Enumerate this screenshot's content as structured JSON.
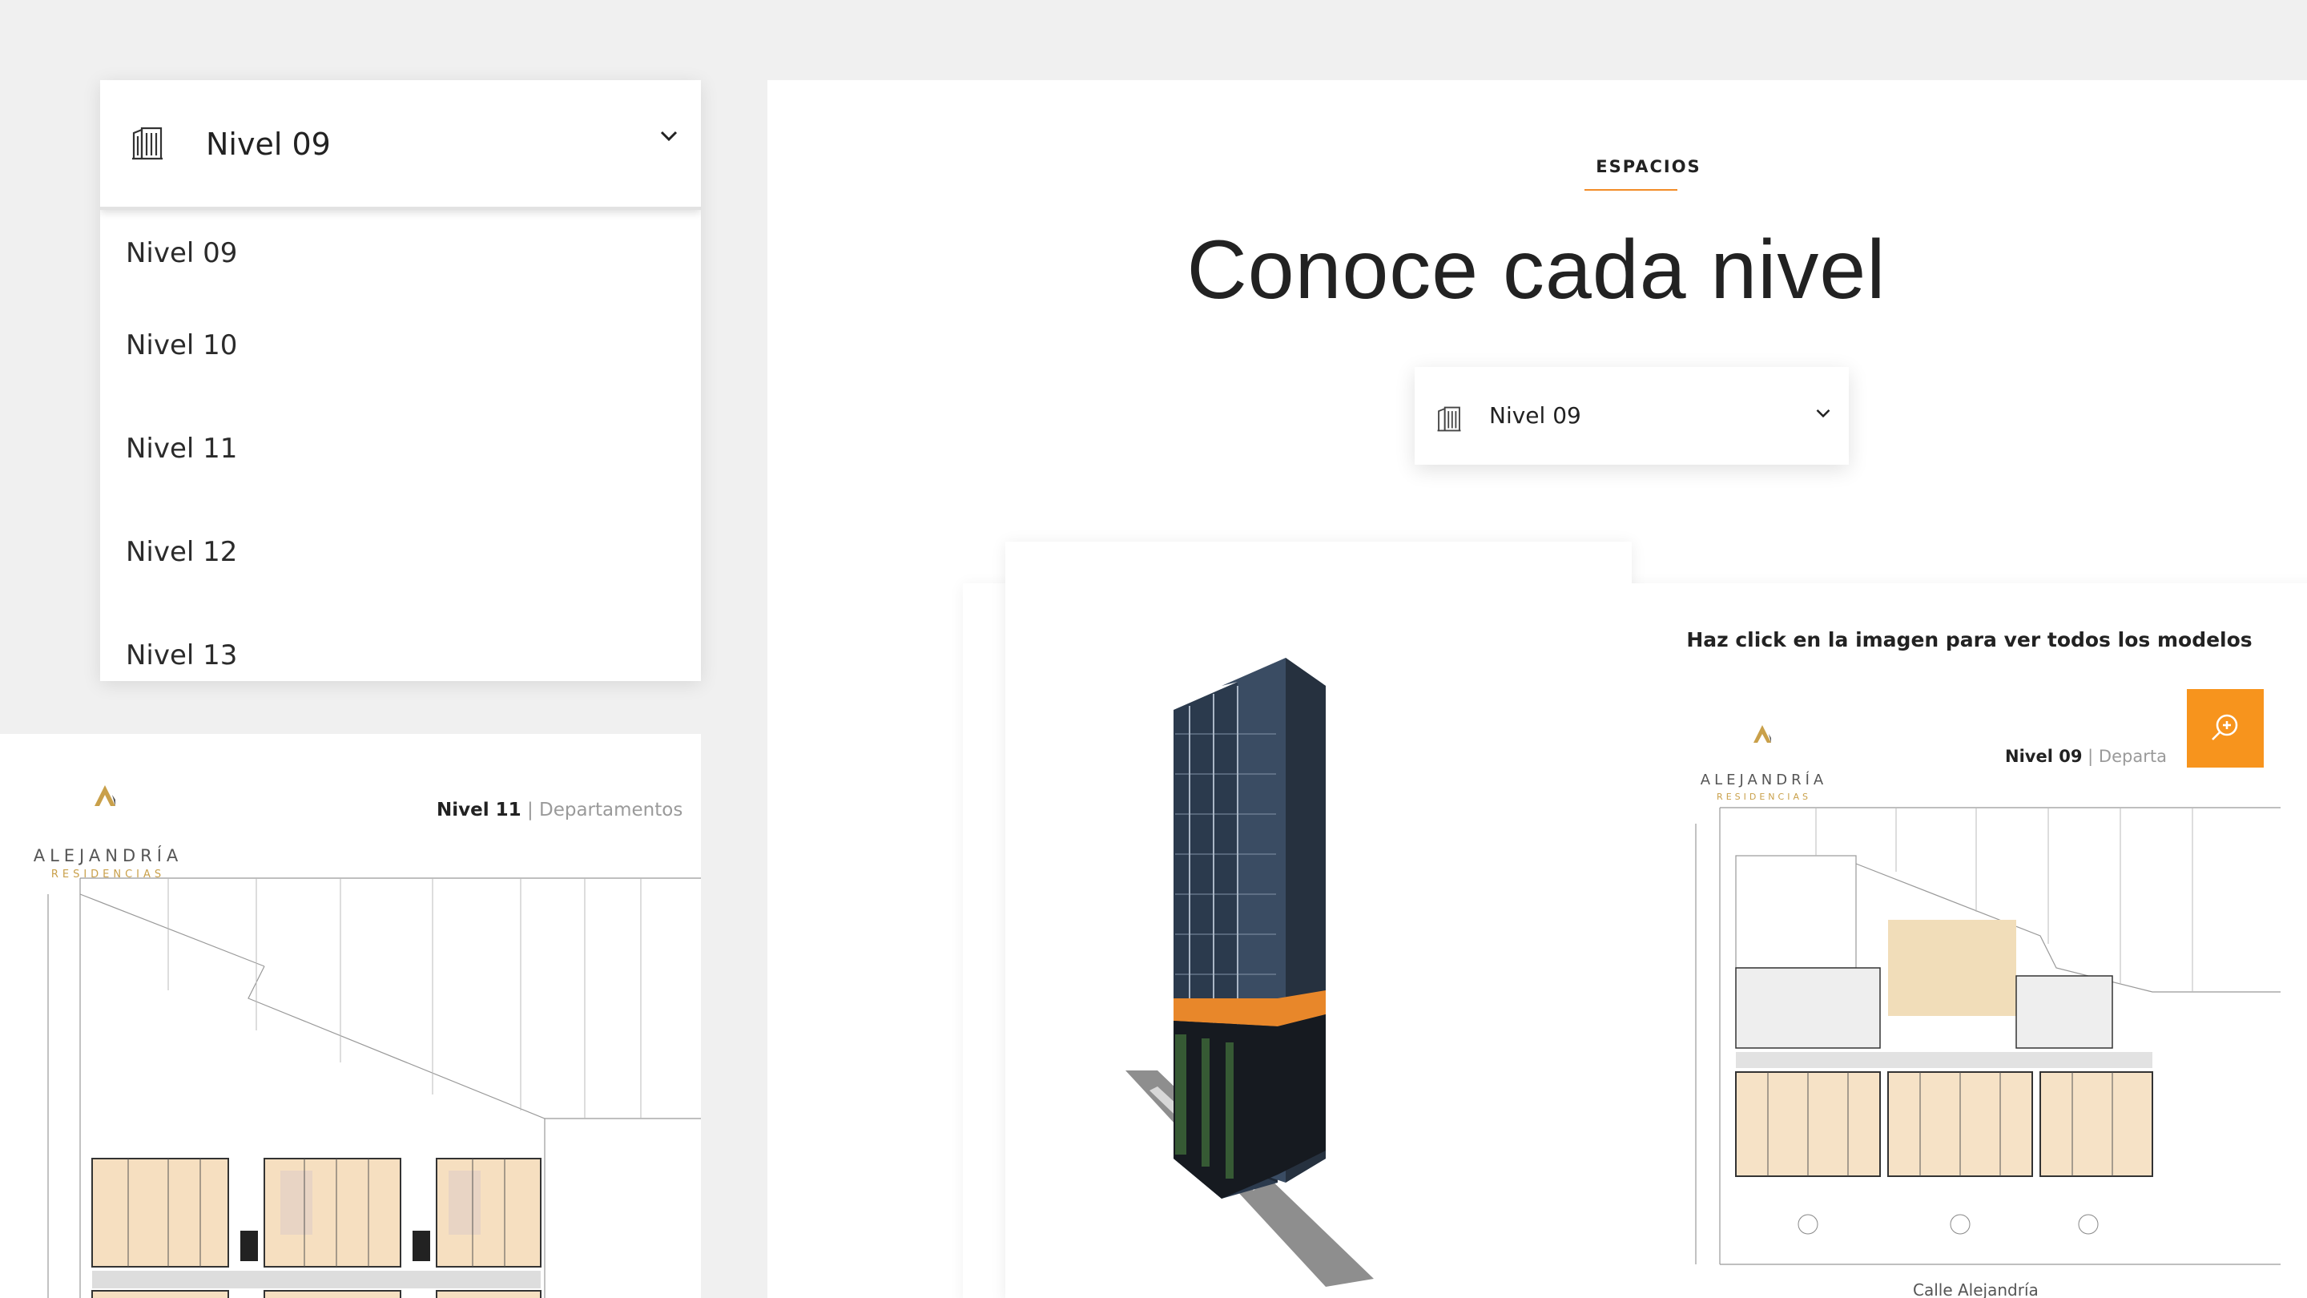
{
  "dropdown": {
    "selected": "Nivel 09",
    "options": [
      "Nivel 09",
      "Nivel 10",
      "Nivel 11",
      "Nivel 12",
      "Nivel 13"
    ]
  },
  "left_plan": {
    "brand_name": "ALEJANDRÍA",
    "brand_tagline": "RESIDENCIAS",
    "level": "Nivel 11",
    "separator": "|",
    "category": "Departamentos"
  },
  "section": {
    "label": "ESPACIOS",
    "title": "Conoce cada nivel"
  },
  "level_select": {
    "selected": "Nivel 09"
  },
  "plan_card": {
    "instruction": "Haz click en la imagen para ver todos los modelos",
    "brand_name": "ALEJANDRÍA",
    "brand_tagline": "RESIDENCIAS",
    "level": "Nivel 09",
    "separator": "|",
    "category": "Departa",
    "street": "Calle Alejandría"
  },
  "icons": {
    "building": "building-icon",
    "chevron": "chevron-down-icon",
    "zoom": "zoom-in-icon"
  },
  "colors": {
    "accent": "#f7941d",
    "gold": "#c9a04a",
    "background": "#f0f0f0"
  }
}
